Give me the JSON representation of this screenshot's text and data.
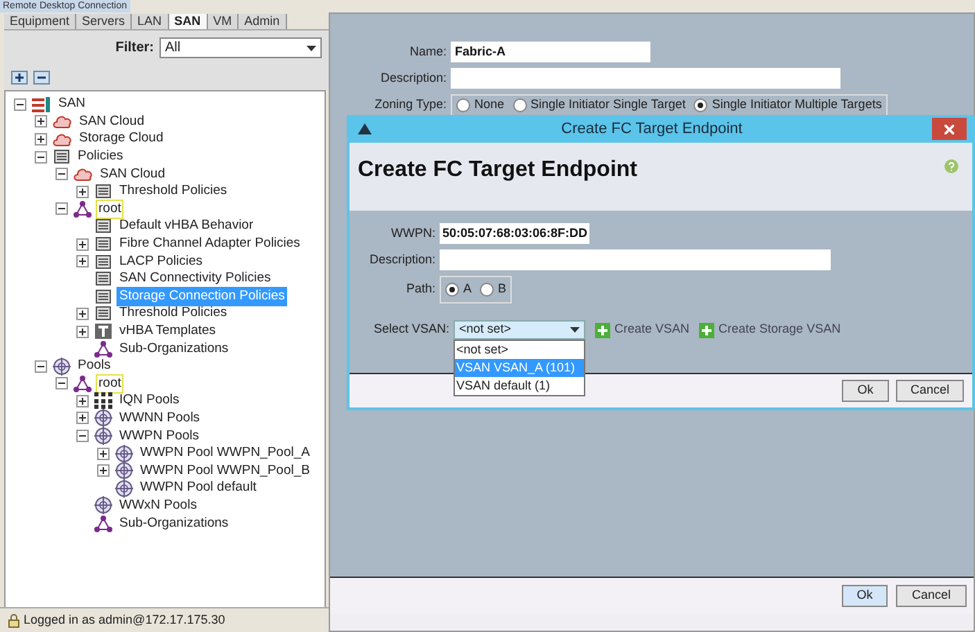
{
  "window": {
    "title": "Remote Desktop Connection"
  },
  "tabs": [
    {
      "label": "Equipment",
      "selected": false
    },
    {
      "label": "Servers",
      "selected": false
    },
    {
      "label": "LAN",
      "selected": false
    },
    {
      "label": "SAN",
      "selected": true
    },
    {
      "label": "VM",
      "selected": false
    },
    {
      "label": "Admin",
      "selected": false
    }
  ],
  "filter": {
    "label": "Filter:",
    "value": "All"
  },
  "tree": [
    {
      "label": "SAN",
      "kind": "san",
      "expanded": true,
      "selected": false,
      "children": [
        {
          "label": "SAN Cloud",
          "kind": "cloud",
          "expanded": false,
          "selected": false
        },
        {
          "label": "Storage Cloud",
          "kind": "cloud",
          "expanded": false,
          "selected": false
        },
        {
          "label": "Policies",
          "kind": "policy",
          "expanded": true,
          "selected": false,
          "children": [
            {
              "label": "SAN Cloud",
              "kind": "cloud",
              "expanded": true,
              "selected": false,
              "children": [
                {
                  "label": "Threshold Policies",
                  "kind": "policy",
                  "expanded": false,
                  "selected": false
                }
              ]
            },
            {
              "label": "root",
              "kind": "org",
              "expanded": true,
              "selected": false,
              "marked": true,
              "children": [
                {
                  "label": "Default vHBA Behavior",
                  "kind": "policy",
                  "selected": false
                },
                {
                  "label": "Fibre Channel Adapter Policies",
                  "kind": "policy",
                  "expanded": false,
                  "selected": false
                },
                {
                  "label": "LACP Policies",
                  "kind": "policy",
                  "expanded": false,
                  "selected": false
                },
                {
                  "label": "SAN Connectivity Policies",
                  "kind": "policy",
                  "selected": false
                },
                {
                  "label": "Storage Connection Policies",
                  "kind": "policy",
                  "selected": true
                },
                {
                  "label": "Threshold Policies",
                  "kind": "policy",
                  "expanded": false,
                  "selected": false
                },
                {
                  "label": "vHBA Templates",
                  "kind": "template",
                  "expanded": false,
                  "selected": false
                },
                {
                  "label": "Sub-Organizations",
                  "kind": "org",
                  "selected": false
                }
              ]
            }
          ]
        },
        {
          "label": "Pools",
          "kind": "pool",
          "expanded": true,
          "selected": false,
          "children": [
            {
              "label": "root",
              "kind": "org",
              "expanded": true,
              "selected": false,
              "marked": true,
              "children": [
                {
                  "label": "IQN Pools",
                  "kind": "iqn",
                  "expanded": false,
                  "selected": false
                },
                {
                  "label": "WWNN Pools",
                  "kind": "pool",
                  "expanded": false,
                  "selected": false
                },
                {
                  "label": "WWPN Pools",
                  "kind": "pool",
                  "expanded": true,
                  "selected": false,
                  "children": [
                    {
                      "label": "WWPN Pool WWPN_Pool_A",
                      "kind": "pool",
                      "expanded": false,
                      "selected": false
                    },
                    {
                      "label": "WWPN Pool WWPN_Pool_B",
                      "kind": "pool",
                      "expanded": false,
                      "selected": false
                    },
                    {
                      "label": "WWPN Pool default",
                      "kind": "pool",
                      "selected": false
                    }
                  ]
                },
                {
                  "label": "WWxN Pools",
                  "kind": "pool",
                  "selected": false
                },
                {
                  "label": "Sub-Organizations",
                  "kind": "org",
                  "selected": false
                }
              ]
            }
          ]
        }
      ]
    }
  ],
  "form": {
    "name_label": "Name:",
    "name_value": "Fabric-A",
    "description_label": "Description:",
    "zoning_label": "Zoning Type:",
    "zoning_options": [
      {
        "label": "None",
        "selected": false
      },
      {
        "label": "Single Initiator Single Target",
        "selected": false
      },
      {
        "label": "Single Initiator Multiple Targets",
        "selected": true
      }
    ]
  },
  "dialog": {
    "title": "Create FC Target Endpoint",
    "heading": "Create FC Target Endpoint",
    "wwpn_label": "WWPN:",
    "wwpn_value": "50:05:07:68:03:06:8F:DD",
    "description_label": "Description:",
    "path_label": "Path:",
    "path_options": [
      {
        "label": "A",
        "selected": true
      },
      {
        "label": "B",
        "selected": false
      }
    ],
    "vsan_label": "Select VSAN:",
    "vsan_value": "<not set>",
    "vsan_options": [
      {
        "label": "<not set>",
        "selected": false
      },
      {
        "label": "VSAN VSAN_A (101)",
        "selected": true
      },
      {
        "label": "VSAN default (1)",
        "selected": false
      }
    ],
    "links": [
      "Create VSAN",
      "Create Storage VSAN"
    ],
    "buttons": [
      "Ok",
      "Cancel"
    ]
  },
  "footer_buttons": [
    "Ok",
    "Cancel"
  ],
  "status_bar": "Logged in as admin@172.17.175.30"
}
